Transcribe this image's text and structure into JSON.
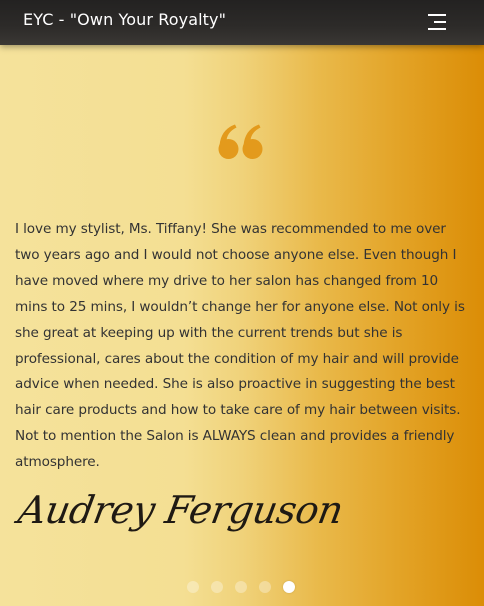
{
  "header": {
    "brand_title": "EYC - \"Own Your Royalty\"",
    "menu_icon": "hamburger-menu-icon"
  },
  "testimonial": {
    "quote_icon": "quote-open-icon",
    "text": "I love my stylist, Ms. Tiffany! She was recommended to me over two years ago and I would not choose anyone else. Even though I have moved where my drive to her salon has changed from 10 mins to 25 mins, I wouldn’t change her for anyone else. Not only is she great at keeping up with the current trends but she is professional, cares about the condition of my hair and will provide advice when needed. She is also proactive in suggesting the best hair care products and how to take care of my hair between visits. Not to mention the Salon is ALWAYS clean and provides a friendly atmosphere.",
    "author": "Audrey Ferguson"
  },
  "carousel": {
    "slide_count": 5,
    "active_index": 4
  },
  "colors": {
    "header_bg": "#2b2927",
    "quote_accent": "#e39a1c",
    "gradient_left": "#f5e29b",
    "gradient_right": "#db8d06",
    "text": "#333333"
  }
}
